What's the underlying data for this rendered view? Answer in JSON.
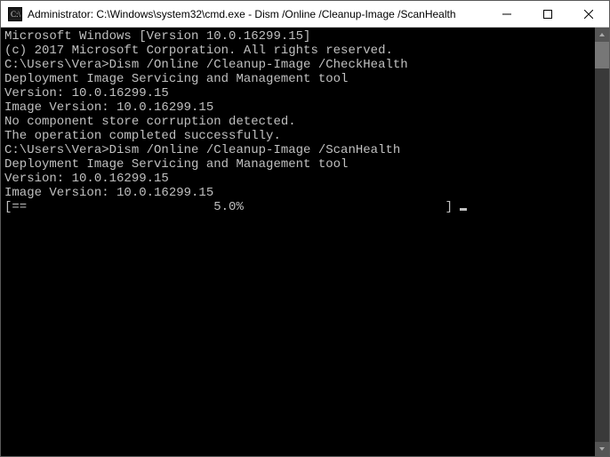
{
  "titlebar": {
    "text": "Administrator: C:\\Windows\\system32\\cmd.exe - Dism  /Online /Cleanup-Image /ScanHealth"
  },
  "console": {
    "lines": [
      "Microsoft Windows [Version 10.0.16299.15]",
      "(c) 2017 Microsoft Corporation. All rights reserved.",
      "",
      "C:\\Users\\Vera>Dism /Online /Cleanup-Image /CheckHealth",
      "",
      "Deployment Image Servicing and Management tool",
      "Version: 10.0.16299.15",
      "",
      "Image Version: 10.0.16299.15",
      "",
      "No component store corruption detected.",
      "The operation completed successfully.",
      "",
      "C:\\Users\\Vera>Dism /Online /Cleanup-Image /ScanHealth",
      "",
      "Deployment Image Servicing and Management tool",
      "Version: 10.0.16299.15",
      "",
      "Image Version: 10.0.16299.15",
      "",
      "[==                         5.0%                           ] "
    ]
  }
}
